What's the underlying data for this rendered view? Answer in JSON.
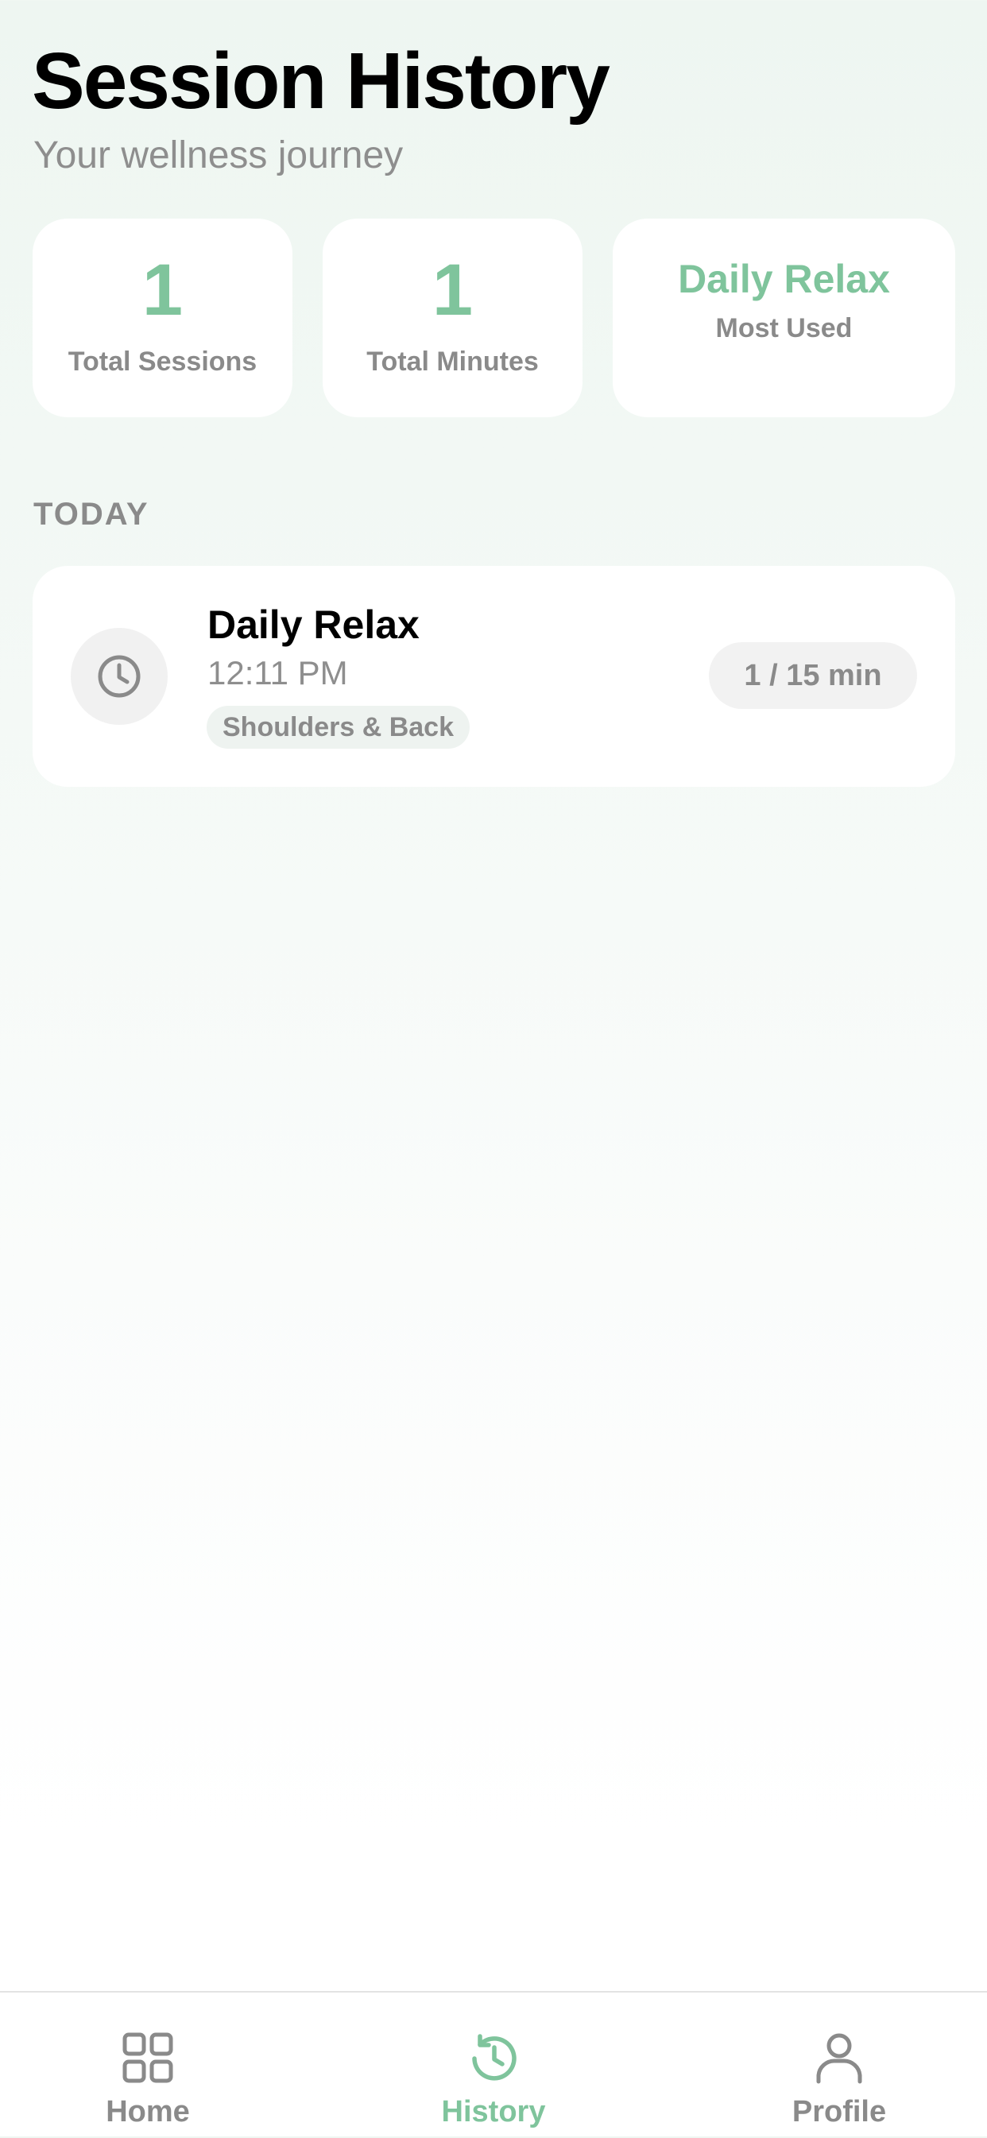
{
  "header": {
    "title": "Session History",
    "subtitle": "Your wellness journey"
  },
  "stats": {
    "total_sessions": {
      "value": "1",
      "label": "Total Sessions"
    },
    "total_minutes": {
      "value": "1",
      "label": "Total Minutes"
    },
    "most_used": {
      "value": "Daily Relax",
      "label": "Most Used"
    }
  },
  "sections": [
    {
      "heading": "TODAY",
      "sessions": [
        {
          "name": "Daily Relax",
          "time": "12:11 PM",
          "tag": "Shoulders & Back",
          "duration": "1 / 15 min",
          "icon": "clock-icon"
        }
      ]
    }
  ],
  "tab_bar": {
    "tabs": [
      {
        "label": "Home",
        "icon": "grid-icon",
        "active": false
      },
      {
        "label": "History",
        "icon": "history-icon",
        "active": true
      },
      {
        "label": "Profile",
        "icon": "person-icon",
        "active": false
      }
    ]
  },
  "colors": {
    "accent": "#7fc49c",
    "secondary_text": "#8a8a8a",
    "card_background": "#ffffff"
  }
}
